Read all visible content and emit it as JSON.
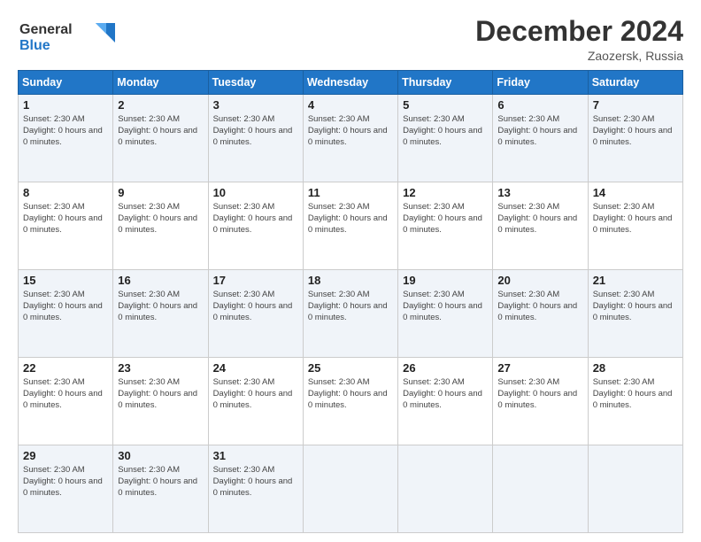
{
  "header": {
    "logo_line1": "General",
    "logo_line2": "Blue",
    "month_year": "December 2024",
    "location": "Zaozersk, Russia"
  },
  "days_of_week": [
    "Sunday",
    "Monday",
    "Tuesday",
    "Wednesday",
    "Thursday",
    "Friday",
    "Saturday"
  ],
  "day_info_template": {
    "sunset": "Sunset: 2:30 AM",
    "daylight": "Daylight: 0 hours and 0 minutes."
  },
  "weeks": [
    [
      {
        "num": "1",
        "has_data": true
      },
      {
        "num": "2",
        "has_data": true
      },
      {
        "num": "3",
        "has_data": true
      },
      {
        "num": "4",
        "has_data": true
      },
      {
        "num": "5",
        "has_data": true
      },
      {
        "num": "6",
        "has_data": true
      },
      {
        "num": "7",
        "has_data": true
      }
    ],
    [
      {
        "num": "8",
        "has_data": true
      },
      {
        "num": "9",
        "has_data": true
      },
      {
        "num": "10",
        "has_data": true
      },
      {
        "num": "11",
        "has_data": true
      },
      {
        "num": "12",
        "has_data": true
      },
      {
        "num": "13",
        "has_data": true
      },
      {
        "num": "14",
        "has_data": true
      }
    ],
    [
      {
        "num": "15",
        "has_data": true
      },
      {
        "num": "16",
        "has_data": true
      },
      {
        "num": "17",
        "has_data": true
      },
      {
        "num": "18",
        "has_data": true
      },
      {
        "num": "19",
        "has_data": true
      },
      {
        "num": "20",
        "has_data": true
      },
      {
        "num": "21",
        "has_data": true
      }
    ],
    [
      {
        "num": "22",
        "has_data": true
      },
      {
        "num": "23",
        "has_data": true
      },
      {
        "num": "24",
        "has_data": true
      },
      {
        "num": "25",
        "has_data": true
      },
      {
        "num": "26",
        "has_data": true
      },
      {
        "num": "27",
        "has_data": true
      },
      {
        "num": "28",
        "has_data": true
      }
    ],
    [
      {
        "num": "29",
        "has_data": true
      },
      {
        "num": "30",
        "has_data": true
      },
      {
        "num": "31",
        "has_data": true
      },
      {
        "num": "",
        "has_data": false
      },
      {
        "num": "",
        "has_data": false
      },
      {
        "num": "",
        "has_data": false
      },
      {
        "num": "",
        "has_data": false
      }
    ]
  ]
}
